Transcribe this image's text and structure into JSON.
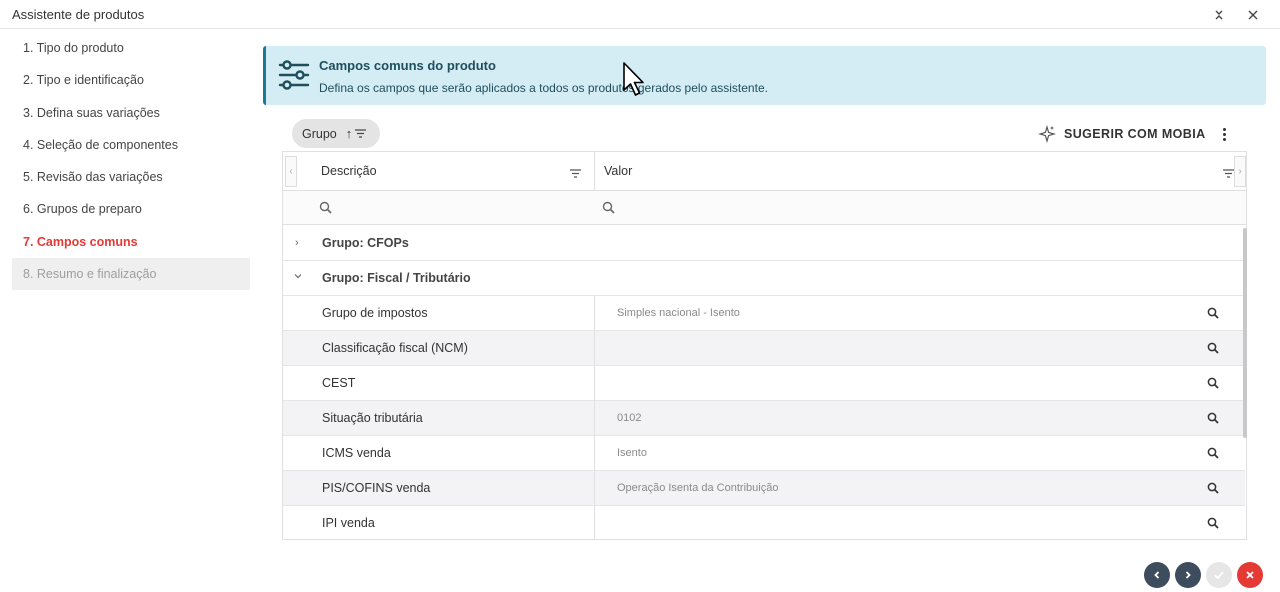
{
  "window": {
    "title": "Assistente de produtos"
  },
  "sidebar": {
    "steps": [
      {
        "label": "1. Tipo do produto",
        "state": "normal"
      },
      {
        "label": "2. Tipo e identificação",
        "state": "normal"
      },
      {
        "label": "3. Defina suas variações",
        "state": "normal"
      },
      {
        "label": "4. Seleção de componentes",
        "state": "normal"
      },
      {
        "label": "5. Revisão das variações",
        "state": "normal"
      },
      {
        "label": "6. Grupos de preparo",
        "state": "normal"
      },
      {
        "label": "7. Campos comuns",
        "state": "active"
      },
      {
        "label": "8. Resumo e finalização",
        "state": "disabled"
      }
    ]
  },
  "banner": {
    "title": "Campos comuns do produto",
    "subtitle": "Defina os campos que serão aplicados a todos os produtos gerados pelo assistente."
  },
  "toolbar": {
    "group_chip": "Grupo",
    "suggest_label": "SUGERIR COM MOBIA"
  },
  "grid": {
    "columns": [
      "Descrição",
      "Valor"
    ],
    "groups": [
      {
        "title": "Grupo: CFOPs",
        "expanded": false
      },
      {
        "title": "Grupo: Fiscal / Tributário",
        "expanded": true
      }
    ],
    "rows": [
      {
        "label": "Grupo de impostos",
        "value": "Simples nacional - Isento"
      },
      {
        "label": "Classificação fiscal (NCM)",
        "value": ""
      },
      {
        "label": "CEST",
        "value": ""
      },
      {
        "label": "Situação tributária",
        "value": "0102"
      },
      {
        "label": "ICMS venda",
        "value": "Isento"
      },
      {
        "label": "PIS/COFINS venda",
        "value": "Operação Isenta da Contribuição"
      },
      {
        "label": "IPI venda",
        "value": ""
      }
    ]
  },
  "colors": {
    "active_step": "#e53935",
    "banner_bg": "#d4ecf4",
    "banner_accent": "#1b7a93",
    "nav_dark": "#3d4d5e",
    "confirm_disabled": "#e6e6e6",
    "cancel": "#e53935"
  }
}
